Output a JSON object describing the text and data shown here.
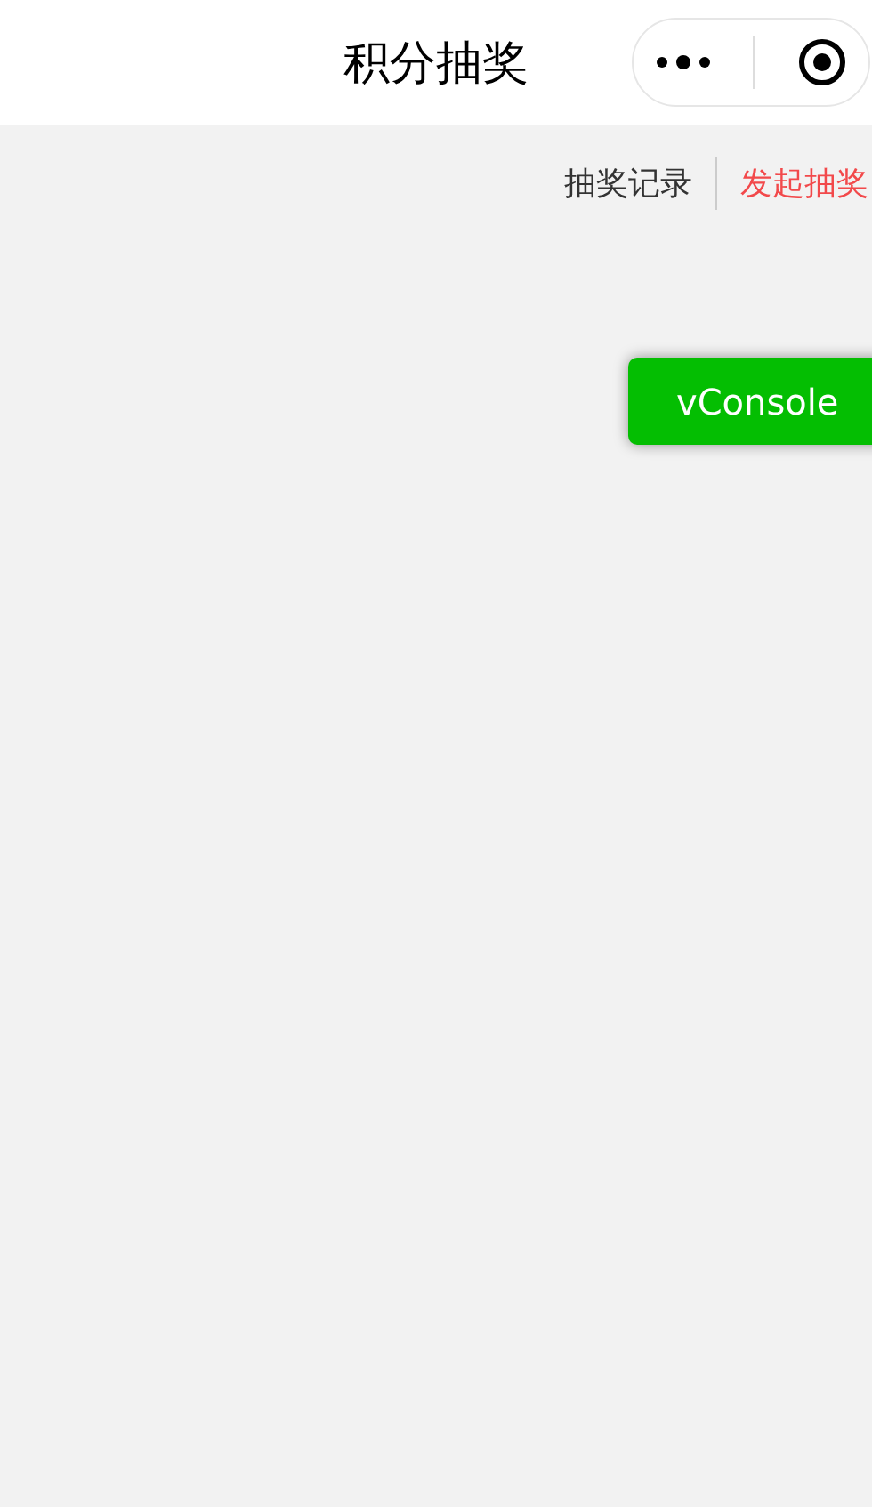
{
  "nav_bar": {
    "title": "积分抽奖"
  },
  "links": [
    {
      "label": "抽奖记录",
      "color": "#333333"
    },
    {
      "label": "发起抽奖",
      "color": "#f2494b"
    }
  ],
  "floating_button": {
    "label": "vConsole"
  }
}
